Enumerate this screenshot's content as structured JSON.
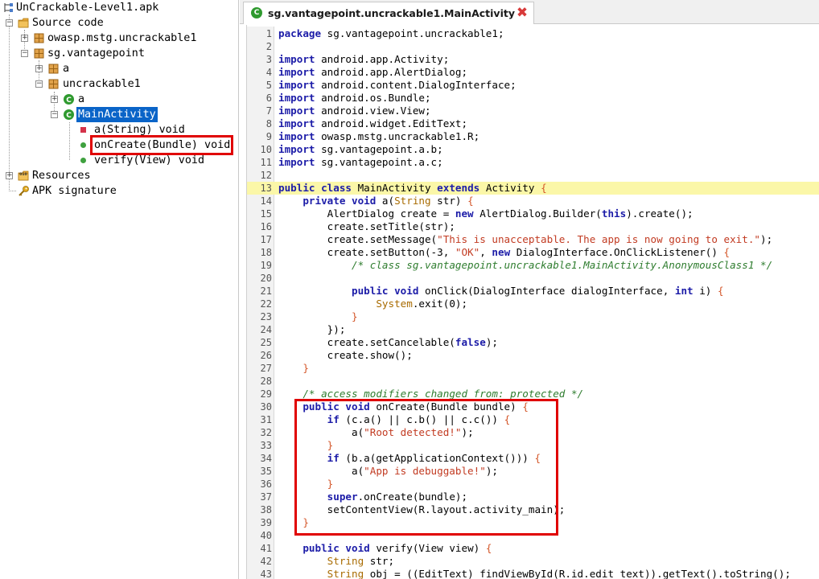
{
  "tree": {
    "root": "UnCrackable-Level1.apk",
    "source_code": "Source code",
    "pkg_owasp": "owasp.mstg.uncrackable1",
    "pkg_sg": "sg.vantagepoint",
    "pkg_a": "a",
    "pkg_uncrackable": "uncrackable1",
    "class_a": "a",
    "class_main": "MainActivity",
    "method_a": "a(String) void",
    "method_oncreate": "onCreate(Bundle) void",
    "method_verify": "verify(View) void",
    "resources": "Resources",
    "signature": "APK signature"
  },
  "tab": {
    "label": "sg.vantagepoint.uncrackable1.MainActivity",
    "icon": "class-icon",
    "close": "✖"
  },
  "code": [
    {
      "n": "1",
      "html": "<span class='k'>package</span> sg.vantagepoint.uncrackable1;"
    },
    {
      "n": "2",
      "html": ""
    },
    {
      "n": "3",
      "html": "<span class='k'>import</span> android.app.Activity;"
    },
    {
      "n": "4",
      "html": "<span class='k'>import</span> android.app.AlertDialog;"
    },
    {
      "n": "5",
      "html": "<span class='k'>import</span> android.content.DialogInterface;"
    },
    {
      "n": "6",
      "html": "<span class='k'>import</span> android.os.Bundle;"
    },
    {
      "n": "7",
      "html": "<span class='k'>import</span> android.view.View;"
    },
    {
      "n": "8",
      "html": "<span class='k'>import</span> android.widget.EditText;"
    },
    {
      "n": "9",
      "html": "<span class='k'>import</span> owasp.mstg.uncrackable1.R;"
    },
    {
      "n": "10",
      "html": "<span class='k'>import</span> sg.vantagepoint.a.b;"
    },
    {
      "n": "11",
      "html": "<span class='k'>import</span> sg.vantagepoint.a.c;"
    },
    {
      "n": "12",
      "html": ""
    },
    {
      "n": "13",
      "html": "<span class='k'>public class</span> MainActivity <span class='k'>extends</span> Activity <span class='p'>{</span>",
      "hl": true
    },
    {
      "n": "14",
      "html": "    <span class='k'>private void</span> a(<span class='t'>String</span> str) <span class='p'>{</span>"
    },
    {
      "n": "15",
      "html": "        AlertDialog create = <span class='k'>new</span> AlertDialog.Builder(<span class='k'>this</span>).create();"
    },
    {
      "n": "16",
      "html": "        create.setTitle(str);"
    },
    {
      "n": "17",
      "html": "        create.setMessage(<span class='s'>\"This is unacceptable. The app is now going to exit.\"</span>);"
    },
    {
      "n": "18",
      "html": "        create.setButton(-3, <span class='s'>\"OK\"</span>, <span class='k'>new</span> DialogInterface.OnClickListener() <span class='p'>{</span>"
    },
    {
      "n": "19",
      "html": "            <span class='c'>/* class sg.vantagepoint.uncrackable1.MainActivity.AnonymousClass1 */</span>"
    },
    {
      "n": "20",
      "html": ""
    },
    {
      "n": "21",
      "html": "            <span class='k'>public void</span> onClick(DialogInterface dialogInterface, <span class='k'>int</span> i) <span class='p'>{</span>"
    },
    {
      "n": "22",
      "html": "                <span class='t'>System</span>.exit(0);"
    },
    {
      "n": "23",
      "html": "            <span class='p'>}</span>"
    },
    {
      "n": "24",
      "html": "        });"
    },
    {
      "n": "25",
      "html": "        create.setCancelable(<span class='k'>false</span>);"
    },
    {
      "n": "26",
      "html": "        create.show();"
    },
    {
      "n": "27",
      "html": "    <span class='p'>}</span>"
    },
    {
      "n": "28",
      "html": ""
    },
    {
      "n": "29",
      "html": "    <span class='c'>/* access modifiers changed from: protected */</span>"
    },
    {
      "n": "30",
      "html": "    <span class='k'>public void</span> onCreate(Bundle bundle) <span class='p'>{</span>"
    },
    {
      "n": "31",
      "html": "        <span class='k'>if</span> (c.a() || c.b() || c.c()) <span class='p'>{</span>"
    },
    {
      "n": "32",
      "html": "            a(<span class='s'>\"Root detected!\"</span>);"
    },
    {
      "n": "33",
      "html": "        <span class='p'>}</span>"
    },
    {
      "n": "34",
      "html": "        <span class='k'>if</span> (b.a(getApplicationContext())) <span class='p'>{</span>"
    },
    {
      "n": "35",
      "html": "            a(<span class='s'>\"App is debuggable!\"</span>);"
    },
    {
      "n": "36",
      "html": "        <span class='p'>}</span>"
    },
    {
      "n": "37",
      "html": "        <span class='k'>super</span>.onCreate(bundle);"
    },
    {
      "n": "38",
      "html": "        setContentView(R.layout.activity_main);"
    },
    {
      "n": "39",
      "html": "    <span class='p'>}</span>"
    },
    {
      "n": "40",
      "html": ""
    },
    {
      "n": "41",
      "html": "    <span class='k'>public void</span> verify(View view) <span class='p'>{</span>"
    },
    {
      "n": "42",
      "html": "        <span class='t'>String</span> str;"
    },
    {
      "n": "43",
      "html": "        <span class='t'>String</span> obj = ((EditText) findViewById(R.id.edit_text)).getText().toString();"
    }
  ],
  "colors": {
    "selection": "#0a64c8",
    "highlight_line": "#fbf7a8",
    "annotation_box": "#e00000",
    "keyword": "#1c1ca8",
    "string": "#c23b22"
  }
}
